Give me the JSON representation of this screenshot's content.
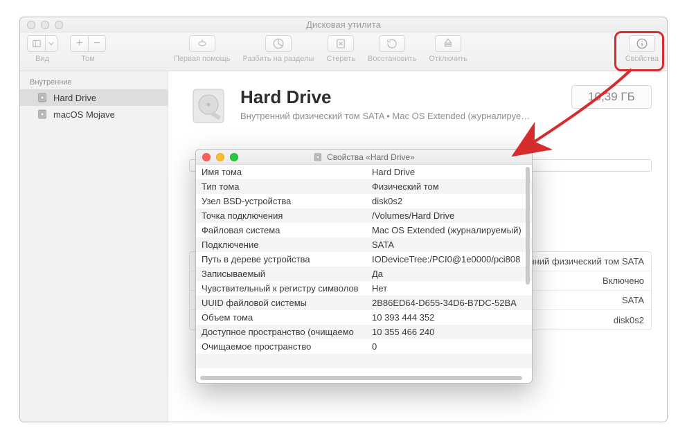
{
  "window": {
    "title": "Дисковая утилита"
  },
  "toolbar": {
    "view": "Вид",
    "volume": "Том",
    "firstAid": "Первая помощь",
    "partition": "Разбить на разделы",
    "erase": "Стереть",
    "restore": "Восстановить",
    "unmount": "Отключить",
    "info": "Свойства"
  },
  "sidebar": {
    "header": "Внутренние",
    "items": [
      {
        "label": "Hard Drive"
      },
      {
        "label": "macOS Mojave"
      }
    ]
  },
  "volume": {
    "title": "Hard Drive",
    "subtitle": "Внутренний физический том SATA • Mac OS Extended (журналируе…",
    "size": "10,39 ГБ"
  },
  "details": {
    "r1v": "тренний физический том SATA",
    "r2v": "Включено",
    "r3v": "SATA",
    "r4v": "disk0s2"
  },
  "popup": {
    "title": "Свойства «Hard Drive»",
    "rows": [
      {
        "k": "Имя тома",
        "v": "Hard Drive"
      },
      {
        "k": "Тип тома",
        "v": "Физический том"
      },
      {
        "k": "Узел BSD-устройства",
        "v": "disk0s2"
      },
      {
        "k": "Точка подключения",
        "v": "/Volumes/Hard Drive"
      },
      {
        "k": "Файловая система",
        "v": "Mac OS Extended (журналируемый)"
      },
      {
        "k": "Подключение",
        "v": "SATA"
      },
      {
        "k": "Путь в дереве устройства",
        "v": "IODeviceTree:/PCI0@1e0000/pci808"
      },
      {
        "k": "Записываемый",
        "v": "Да"
      },
      {
        "k": "Чувствительный к регистру символов",
        "v": "Нет"
      },
      {
        "k": "UUID файловой системы",
        "v": "2B86ED64-D655-34D6-B7DC-52BA"
      },
      {
        "k": "Объем тома",
        "v": "10 393 444 352"
      },
      {
        "k": "Доступное пространство (очищаемо",
        "v": "10 355 466 240"
      },
      {
        "k": "Очищаемое пространство",
        "v": "0"
      },
      {
        "k": "",
        "v": ""
      }
    ]
  }
}
